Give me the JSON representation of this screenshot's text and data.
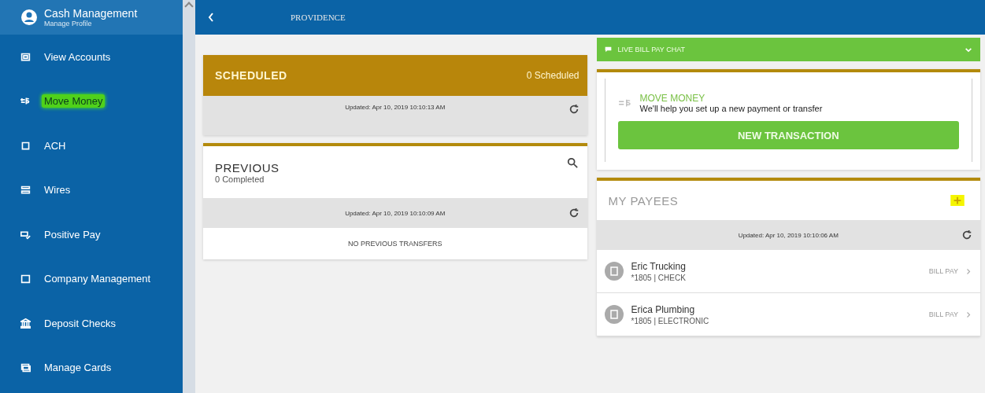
{
  "sidebar": {
    "title": "Cash Management",
    "profile_link": "Manage Profile",
    "items": [
      {
        "label": "View Accounts",
        "selected": false
      },
      {
        "label": "Move Money",
        "selected": true
      },
      {
        "label": "ACH",
        "selected": false
      },
      {
        "label": "Wires",
        "selected": false
      },
      {
        "label": "Positive Pay",
        "selected": false
      },
      {
        "label": "Company Management",
        "selected": false
      },
      {
        "label": "Deposit Checks",
        "selected": false
      },
      {
        "label": "Manage Cards",
        "selected": false
      }
    ]
  },
  "topbar": {
    "logo": "PROVIDENCE"
  },
  "scheduled": {
    "title": "SCHEDULED",
    "count": "0 Scheduled",
    "updated": "Updated: Apr 10, 2019 10:10:13 AM"
  },
  "previous": {
    "title": "PREVIOUS",
    "count": "0 Completed",
    "updated": "Updated: Apr 10, 2019 10:10:09 AM",
    "empty": "NO PREVIOUS TRANSFERS"
  },
  "chat": {
    "label": "LIVE BILL PAY CHAT"
  },
  "move_money": {
    "title": "MOVE MONEY",
    "text": "We'll help you set up a new payment or transfer",
    "button": "NEW TRANSACTION"
  },
  "payees": {
    "title": "MY PAYEES",
    "updated": "Updated: Apr 10, 2019 10:10:06 AM",
    "rows": [
      {
        "name": "Eric Trucking",
        "detail": "*1805 | CHECK",
        "action": "BILL PAY"
      },
      {
        "name": "Erica Plumbing",
        "detail": "*1805 | ELECTRONIC",
        "action": "BILL PAY"
      }
    ]
  }
}
